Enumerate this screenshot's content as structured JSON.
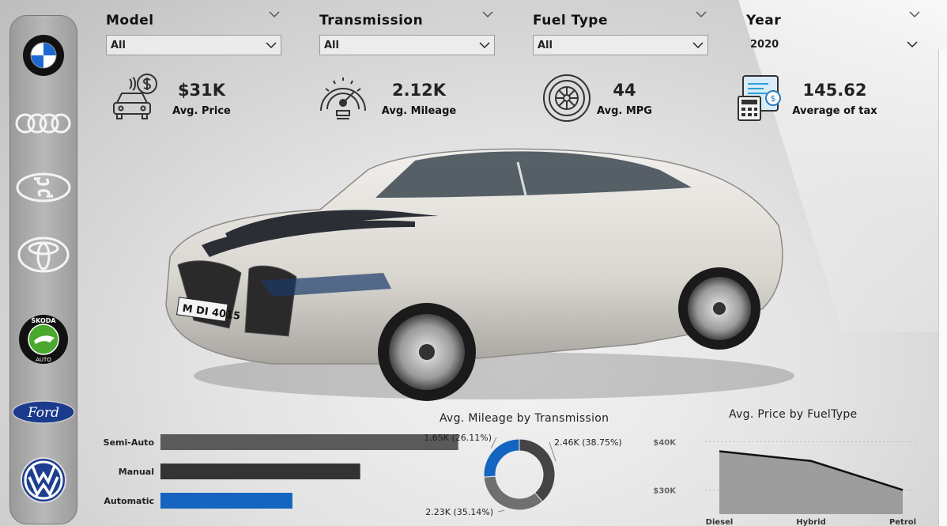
{
  "slicers": [
    {
      "title": "Model",
      "value": "All"
    },
    {
      "title": "Transmission",
      "value": "All"
    },
    {
      "title": "Fuel Type",
      "value": "All"
    },
    {
      "title": "Year",
      "value": "2020"
    }
  ],
  "brands": [
    "BMW",
    "Audi",
    "Hyundai",
    "Toyota",
    "Skoda",
    "Ford",
    "Volkswagen"
  ],
  "brand_icons": [
    "bmw-logo-icon",
    "audi-logo-icon",
    "hyundai-logo-icon",
    "toyota-logo-icon",
    "skoda-logo-icon",
    "ford-logo-icon",
    "volkswagen-logo-icon"
  ],
  "skoda_text": {
    "top": "ŠKODA",
    "bottom": "AUTO"
  },
  "ford_text": "Ford",
  "kpis": [
    {
      "value": "$31K",
      "label": "Avg. Price",
      "icon": "car-price-icon"
    },
    {
      "value": "2.12K",
      "label": "Avg. Mileage",
      "icon": "speedometer-icon"
    },
    {
      "value": "44",
      "label": "Avg. MPG",
      "icon": "tire-icon"
    },
    {
      "value": "145.62",
      "label": "Average of tax",
      "icon": "calculator-tax-icon"
    }
  ],
  "car_plate": "M DI 4015",
  "colors": {
    "accent_blue": "#1565c0",
    "bar_grey": "#5a5a5a",
    "bar_dark": "#333333",
    "donut_dark": "#444444",
    "donut_mid": "#6f6f6f",
    "area_grey": "#999999"
  },
  "chart_data": [
    {
      "type": "bar",
      "orientation": "horizontal",
      "title": "",
      "categories": [
        "Semi-Auto",
        "Manual",
        "Automatic"
      ],
      "values": [
        2.46,
        1.65,
        1.09
      ],
      "value_unit": "K",
      "colors": [
        "#5a5a5a",
        "#333333",
        "#1565c0"
      ],
      "xlim": [
        0,
        3.2
      ]
    },
    {
      "type": "pie",
      "donut": true,
      "title": "Avg. Mileage by Transmission",
      "slices": [
        {
          "label": "2.46K (38.75%)",
          "value": 38.75,
          "color": "#444444"
        },
        {
          "label": "2.23K (35.14%)",
          "value": 35.14,
          "color": "#6f6f6f"
        },
        {
          "label": "1.65K (26.11%)",
          "value": 26.11,
          "color": "#1565c0"
        }
      ]
    },
    {
      "type": "area",
      "title": "Avg. Price by FuelType",
      "categories": [
        "Diesel",
        "Hybrid",
        "Petrol"
      ],
      "values": [
        38,
        36,
        30
      ],
      "y_ticks": [
        30,
        40
      ],
      "y_tick_labels": [
        "$30K",
        "$40K"
      ],
      "ylim": [
        25,
        43
      ],
      "grid": true
    }
  ]
}
